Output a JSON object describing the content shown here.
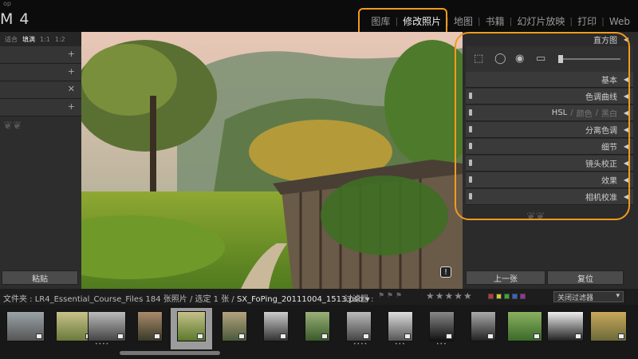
{
  "app": {
    "brand_top": "op",
    "brand": "M 4"
  },
  "modules": [
    {
      "label": "图库"
    },
    {
      "label": "修改照片"
    },
    {
      "label": "地图"
    },
    {
      "label": "书籍"
    },
    {
      "label": "幻灯片放映"
    },
    {
      "label": "打印"
    },
    {
      "label": "Web"
    }
  ],
  "left_panel": {
    "zoom": {
      "fit": "适合",
      "fill": "填满",
      "one": "1:1",
      "ratio": "1:2"
    },
    "paste_label": "粘贴"
  },
  "right_panel": {
    "histogram": "直方图",
    "basic": "基本",
    "tone_curve": "色调曲线",
    "hsl": "HSL",
    "hsl_color": "颜色",
    "hsl_bw": "黑白",
    "split_toning": "分离色调",
    "detail": "细节",
    "lens_correction": "镜头校正",
    "effects": "效果",
    "camera_calibration": "相机校准",
    "previous_label": "上一张",
    "reset_label": "复位"
  },
  "filmstrip_bar": {
    "folder": "文件夹 : LR4_Essential_Course_Files",
    "count": "184 张照片 / 选定 1 张 /",
    "filename": "SX_FoPing_20111004_1513.psd",
    "filter_label": "过滤器 :",
    "filter_select": "关闭过滤器"
  },
  "colors": {
    "accent_highlight": "#f39a1e",
    "panel": "#2b2b2b"
  }
}
